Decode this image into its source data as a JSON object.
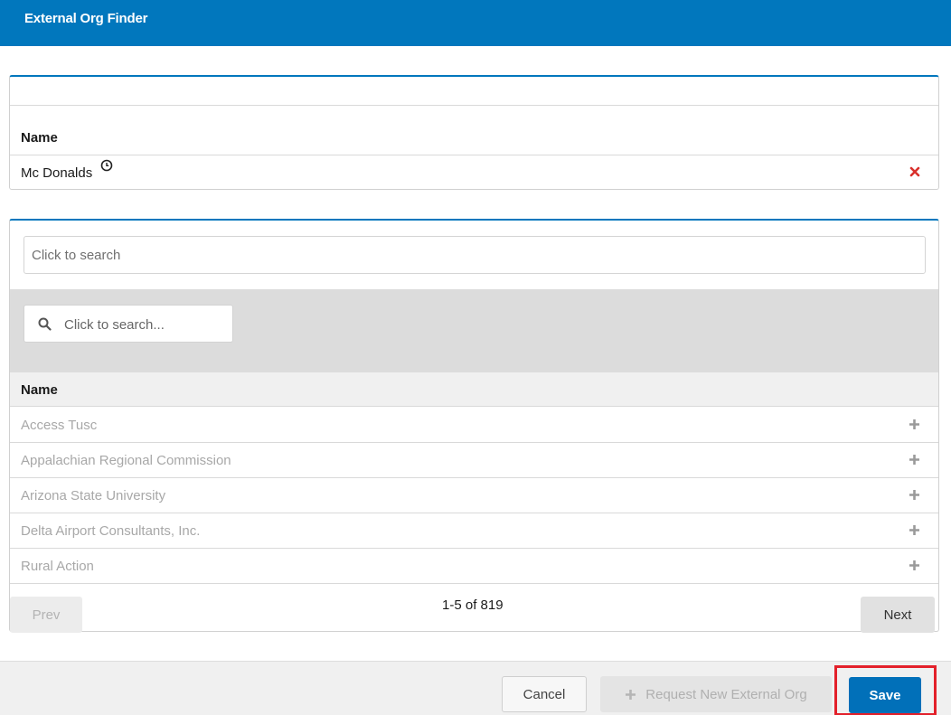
{
  "header": {
    "title": "External Org Finder"
  },
  "selected": {
    "column_header": "Name",
    "items": [
      {
        "name": "Mc Donalds",
        "icons": [
          "clock-icon",
          "remove-icon"
        ]
      }
    ]
  },
  "finder": {
    "top_search_placeholder": "Click to search",
    "inner_search_placeholder": "Click to search...",
    "column_header": "Name",
    "rows": [
      {
        "name": "Access Tusc"
      },
      {
        "name": "Appalachian Regional Commission"
      },
      {
        "name": "Arizona State University"
      },
      {
        "name": "Delta Airport Consultants, Inc."
      },
      {
        "name": "Rural Action"
      }
    ],
    "pager": {
      "prev_label": "Prev",
      "info": "1-5 of 819",
      "next_label": "Next"
    }
  },
  "footer": {
    "cancel_label": "Cancel",
    "request_label": "Request New External Org",
    "save_label": "Save"
  },
  "colors": {
    "brand_blue": "#0177bd",
    "remove_red": "#d9302c",
    "highlight_red": "#e3202a"
  }
}
